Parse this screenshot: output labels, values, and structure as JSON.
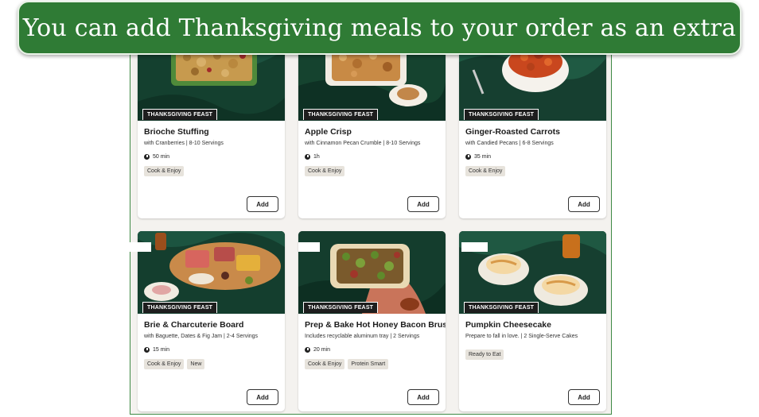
{
  "banner": {
    "text": "You can add Thanksgiving meals to your order as an extra"
  },
  "colors": {
    "banner_bg": "#2f7b35",
    "tag_bg": "#1e1e1e",
    "badge_bg": "#e7e3dc",
    "page_bg": "#f4f2ef"
  },
  "cards": [
    {
      "tag": "THANKSGIVING FEAST",
      "title": "Brioche Stuffing",
      "subtitle": "with Cranberries | 8-10 Servings",
      "time": "50 min",
      "badges": [
        "Cook & Enjoy"
      ],
      "add_label": "Add",
      "image_icon": "stuffing-dish-image"
    },
    {
      "tag": "THANKSGIVING FEAST",
      "title": "Apple Crisp",
      "subtitle": "with Cinnamon Pecan Crumble | 8-10 Servings",
      "time": "1h",
      "badges": [
        "Cook & Enjoy"
      ],
      "add_label": "Add",
      "image_icon": "apple-crisp-image"
    },
    {
      "tag": "THANKSGIVING FEAST",
      "title": "Ginger-Roasted Carrots",
      "subtitle": "with Candied Pecans | 6-8 Servings",
      "time": "35 min",
      "badges": [
        "Cook & Enjoy"
      ],
      "add_label": "Add",
      "image_icon": "carrots-bowl-image"
    },
    {
      "tag": "THANKSGIVING FEAST",
      "title": "Brie & Charcuterie Board",
      "subtitle": "with Baguette, Dates & Fig Jam | 2-4 Servings",
      "time": "15 min",
      "badges": [
        "Cook & Enjoy",
        "New"
      ],
      "add_label": "Add",
      "image_icon": "charcuterie-board-image"
    },
    {
      "tag": "THANKSGIVING FEAST",
      "title": "Prep & Bake Hot Honey Bacon Brussels",
      "subtitle": "Includes recyclable aluminum tray | 2 Servings",
      "time": "20 min",
      "badges": [
        "Cook & Enjoy",
        "Protein Smart"
      ],
      "add_label": "Add",
      "image_icon": "brussels-tray-image"
    },
    {
      "tag": "THANKSGIVING FEAST",
      "title": "Pumpkin Cheesecake",
      "subtitle": "Prepare to fall in love. | 2 Single-Serve Cakes",
      "time": "",
      "badges": [
        "Ready to Eat"
      ],
      "add_label": "Add",
      "image_icon": "cheesecake-plates-image"
    }
  ]
}
